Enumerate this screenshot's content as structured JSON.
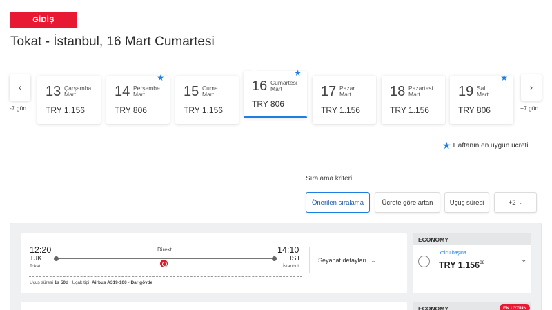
{
  "direction_badge": "GİDİŞ",
  "route_title": "Tokat - İstanbul, 16 Mart Cumartesi",
  "date_nav": {
    "prev_label": "-7 gün",
    "next_label": "+7 gün"
  },
  "date_cards": [
    {
      "day": "13",
      "day_name": "Çarşamba",
      "month": "Mart",
      "price": "TRY 1.156",
      "best_of_week": false,
      "selected": false
    },
    {
      "day": "14",
      "day_name": "Perşembe",
      "month": "Mart",
      "price": "TRY 806",
      "best_of_week": true,
      "selected": false
    },
    {
      "day": "15",
      "day_name": "Cuma",
      "month": "Mart",
      "price": "TRY 1.156",
      "best_of_week": false,
      "selected": false
    },
    {
      "day": "16",
      "day_name": "Cumartesi",
      "month": "Mart",
      "price": "TRY 806",
      "best_of_week": true,
      "selected": true
    },
    {
      "day": "17",
      "day_name": "Pazar",
      "month": "Mart",
      "price": "TRY 1.156",
      "best_of_week": false,
      "selected": false
    },
    {
      "day": "18",
      "day_name": "Pazartesi",
      "month": "Mart",
      "price": "TRY 1.156",
      "best_of_week": false,
      "selected": false
    },
    {
      "day": "19",
      "day_name": "Salı",
      "month": "Mart",
      "price": "TRY 806",
      "best_of_week": true,
      "selected": false
    }
  ],
  "legend": "Haftanın en uygun ücreti",
  "sorting": {
    "label": "Sıralama kriteri",
    "options": [
      "Önerilen sıralama",
      "Ücrete göre artan",
      "Uçuş süresi",
      "+2"
    ],
    "active_index": 0
  },
  "flights": [
    {
      "dep_time": "12:20",
      "dep_code": "TJK",
      "dep_city": "Tokat",
      "arr_time": "14:10",
      "arr_code": "IST",
      "arr_city": "İstanbul",
      "stops": "Direkt",
      "details_label": "Seyahat detayları",
      "duration_label": "Uçuş süresi",
      "duration": "1s 50d",
      "aircraft_label": "Uçak tipi:",
      "aircraft": "Airbus A319-100",
      "body_type": "Dar gövde",
      "fare": {
        "cabin": "ECONOMY",
        "per_pax_label": "Yolcu başına",
        "currency": "TRY",
        "amount": "1.156",
        "decimals": "88"
      }
    }
  ],
  "second_fare": {
    "cabin": "ECONOMY",
    "badge": "EN UYGUN"
  },
  "colors": {
    "brand_red": "#e81932",
    "accent_blue": "#1e7ee4"
  }
}
